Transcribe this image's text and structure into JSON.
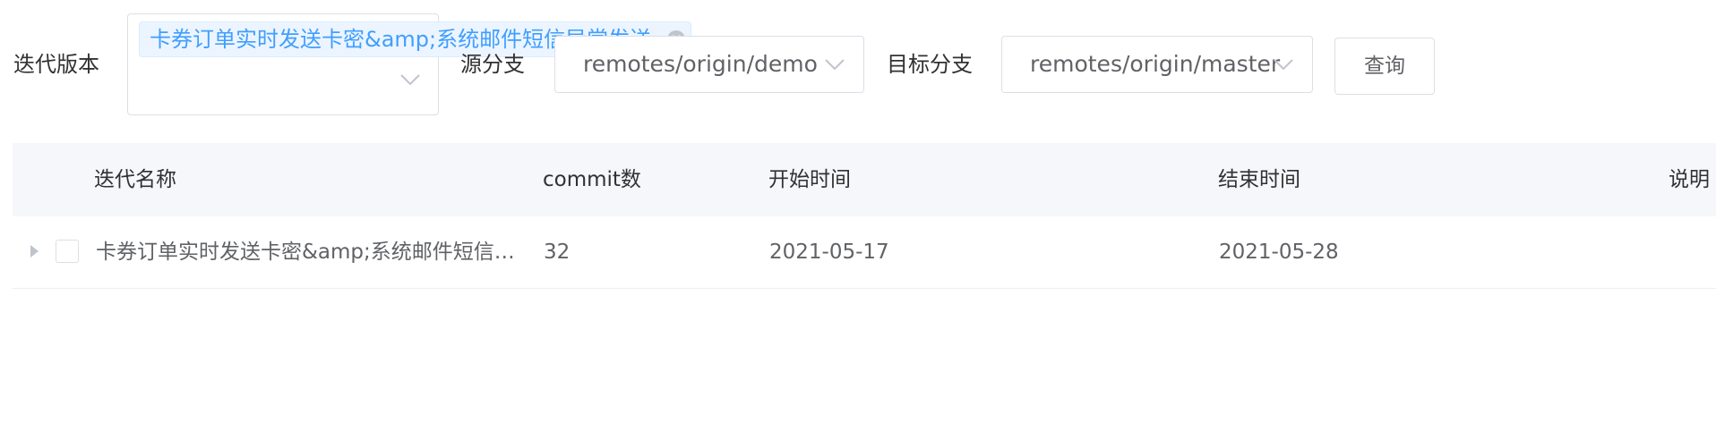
{
  "filters": {
    "iteration_label": "迭代版本",
    "iteration_tag": "卡券订单实时发送卡密&amp;系统邮件短信异常发送",
    "source_label": "源分支",
    "source_value": "remotes/origin/demo",
    "target_label": "目标分支",
    "target_value": "remotes/origin/master",
    "query_button": "查询"
  },
  "table": {
    "columns": [
      "迭代名称",
      "commit数",
      "开始时间",
      "结束时间",
      "说明"
    ],
    "rows": [
      {
        "name": "卡券订单实时发送卡密&amp;系统邮件短信…",
        "commits": "32",
        "start": "2021-05-17",
        "end": "2021-05-28",
        "desc": ""
      }
    ]
  },
  "colors": {
    "primary": "#409eff",
    "tag_bg": "#ecf5ff",
    "header_bg": "#f5f7fa",
    "border": "#dcdfe6"
  },
  "icons": [
    "chevron-down-icon",
    "close-circle-icon",
    "caret-right-icon",
    "checkbox"
  ]
}
